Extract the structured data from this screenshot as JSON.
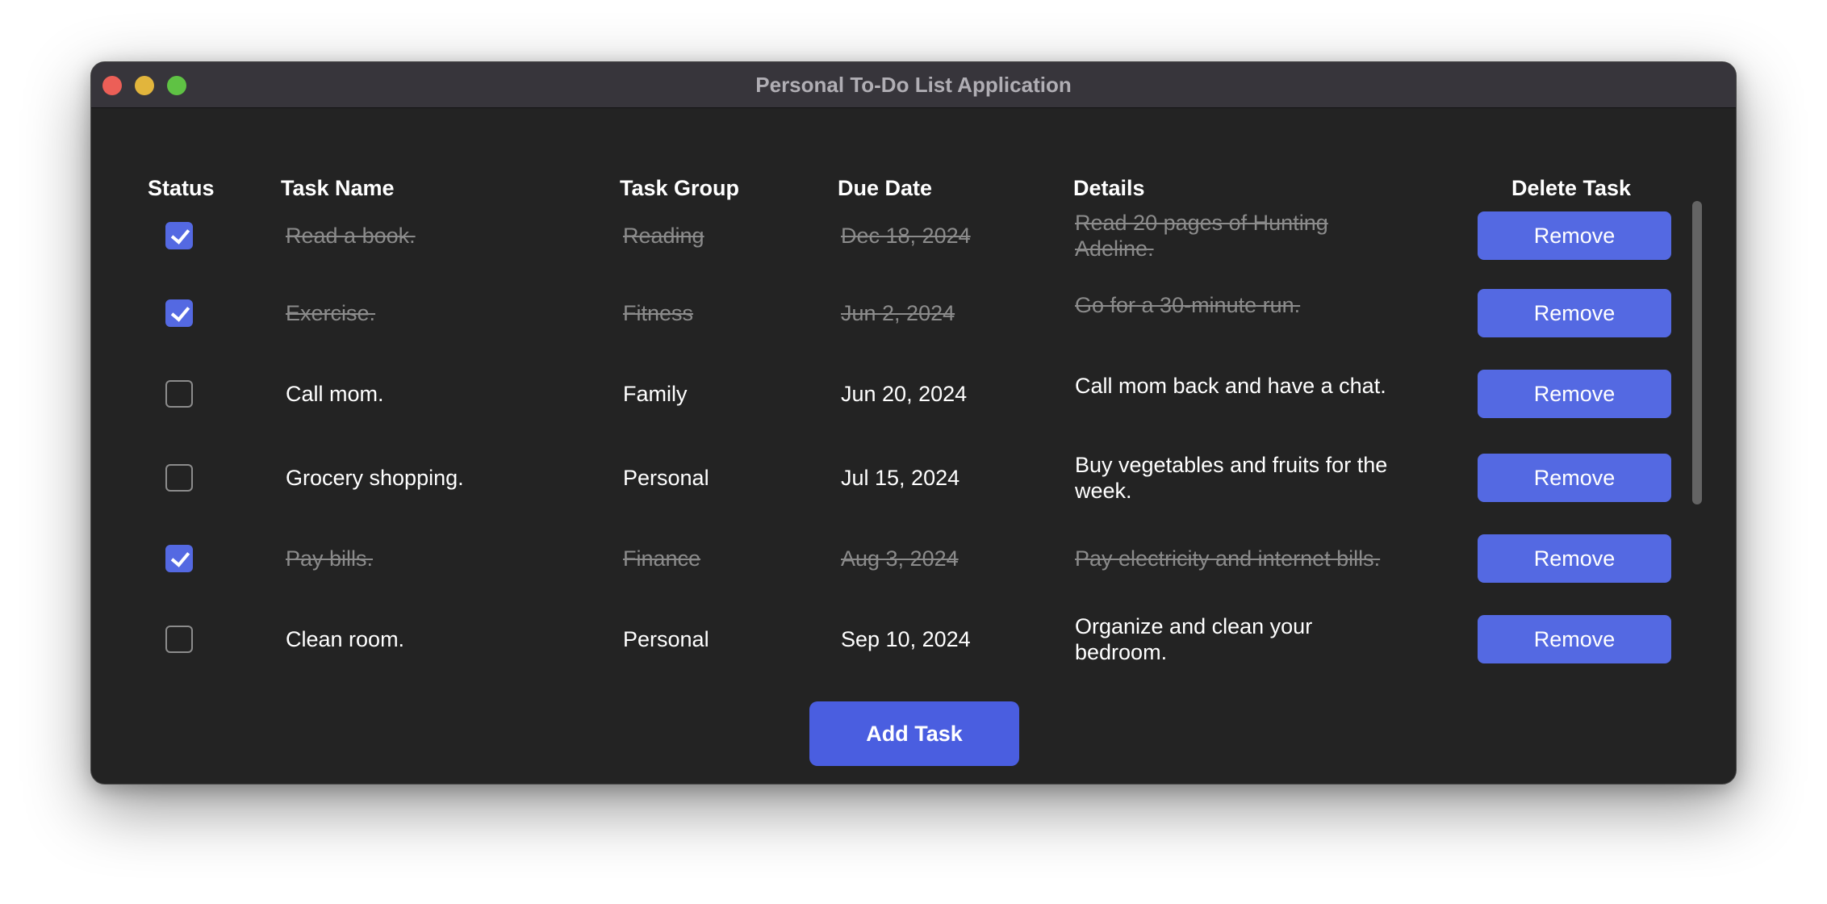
{
  "window": {
    "title": "Personal To-Do List Application"
  },
  "table": {
    "columns": {
      "status": "Status",
      "task_name": "Task Name",
      "task_group": "Task Group",
      "due_date": "Due Date",
      "details": "Details",
      "delete_task": "Delete Task"
    },
    "rows": [
      {
        "done": true,
        "name": "Read a book.",
        "group": "Reading",
        "due": "Dec 18, 2024",
        "details": "Read 20 pages of Hunting Adeline.",
        "remove_label": "Remove"
      },
      {
        "done": true,
        "name": "Exercise.",
        "group": "Fitness",
        "due": "Jun 2, 2024",
        "details": "Go for a 30-minute run.",
        "remove_label": "Remove"
      },
      {
        "done": false,
        "name": "Call mom.",
        "group": "Family",
        "due": "Jun 20, 2024",
        "details": "Call mom back and have a chat.",
        "remove_label": "Remove"
      },
      {
        "done": false,
        "name": "Grocery shopping.",
        "group": "Personal",
        "due": "Jul 15, 2024",
        "details": "Buy vegetables and fruits for the week.",
        "remove_label": "Remove"
      },
      {
        "done": true,
        "name": "Pay bills.",
        "group": "Finance",
        "due": "Aug 3, 2024",
        "details": "Pay electricity and internet bills.",
        "remove_label": "Remove"
      },
      {
        "done": false,
        "name": "Clean room.",
        "group": "Personal",
        "due": "Sep 10, 2024",
        "details": "Organize and clean your bedroom.",
        "remove_label": "Remove"
      }
    ]
  },
  "add_button": {
    "label": "Add Task"
  },
  "colors": {
    "accent": "#5469e2",
    "window_bg": "#232323",
    "titlebar_bg": "#37353b",
    "completed_text": "#8b8b8b"
  }
}
